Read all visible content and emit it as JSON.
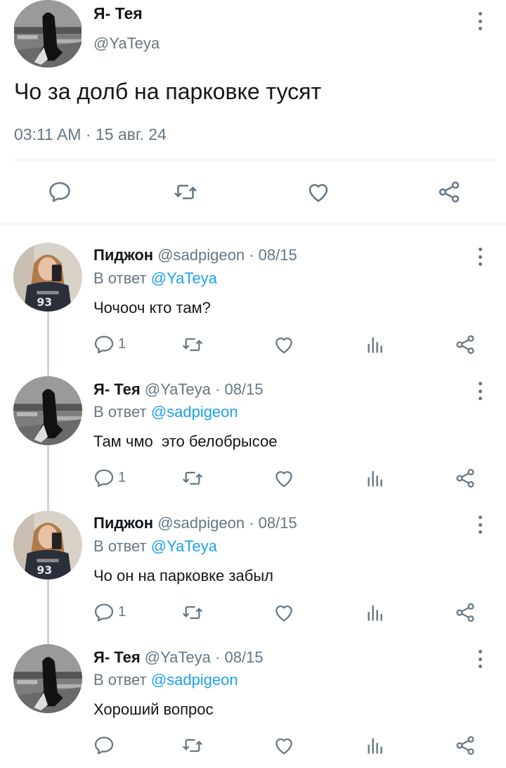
{
  "colors": {
    "text": "#14171a",
    "muted": "#657786",
    "accent": "#1da1f2",
    "divider": "#e6ecf0"
  },
  "main_tweet": {
    "author_name": "Я- Тея",
    "author_handle": "@YaTeya",
    "text": "Чо за долб на парковке тусят",
    "timestamp": "03:11 AM · 15 авг. 24",
    "actions": [
      "reply-icon",
      "retweet-icon",
      "like-icon",
      "share-icon"
    ]
  },
  "replies": [
    {
      "author_name": "Пиджон",
      "author_handle": "@sadpigeon",
      "date": "· 08/15",
      "reply_label": "В ответ",
      "reply_to": "@YaTeya",
      "text": "Чочооч кто там?",
      "reply_count": "1"
    },
    {
      "author_name": "Я- Тея",
      "author_handle": "@YaTeya",
      "date": "· 08/15",
      "reply_label": "В ответ",
      "reply_to": "@sadpigeon",
      "text": "Там чмо  это белобрысое",
      "reply_count": "1"
    },
    {
      "author_name": "Пиджон",
      "author_handle": "@sadpigeon",
      "date": "· 08/15",
      "reply_label": "В ответ",
      "reply_to": "@YaTeya",
      "text": "Чо он на парковке забыл",
      "reply_count": "1"
    },
    {
      "author_name": "Я- Тея",
      "author_handle": "@YaTeya",
      "date": "· 08/15",
      "reply_label": "В ответ",
      "reply_to": "@sadpigeon",
      "text": "Хороший вопрос",
      "reply_count": ""
    }
  ]
}
